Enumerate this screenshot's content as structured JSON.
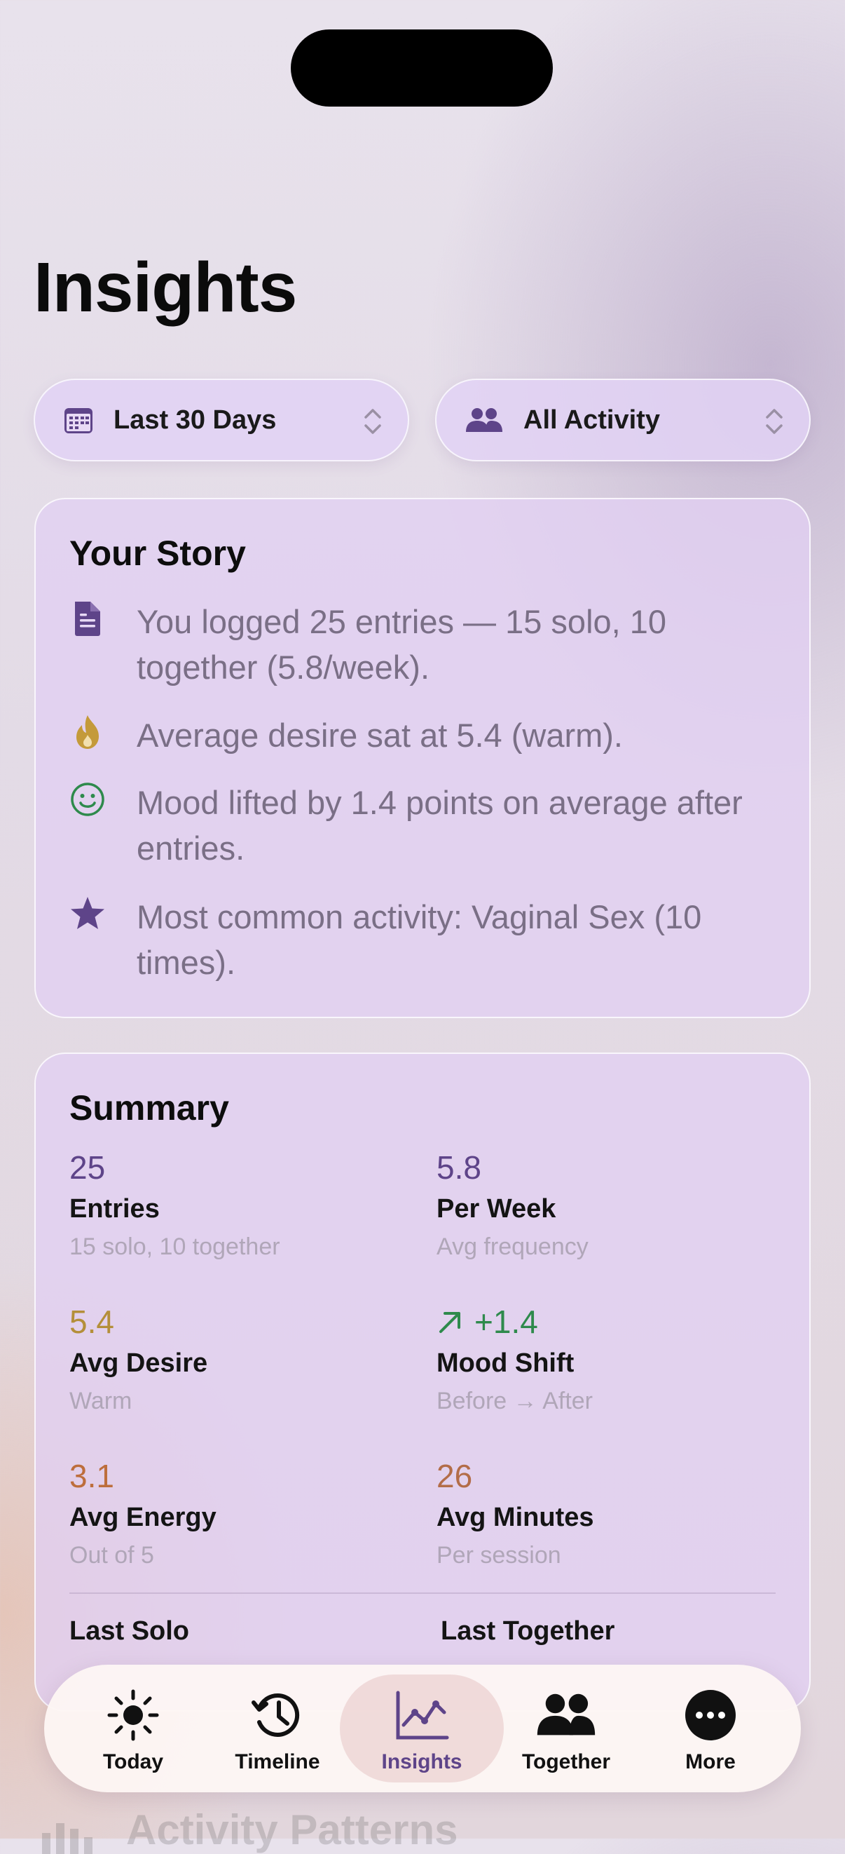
{
  "page": {
    "title": "Insights"
  },
  "filters": {
    "range": {
      "label": "Last 30 Days",
      "icon": "calendar-icon"
    },
    "activity": {
      "label": "All Activity",
      "icon": "people-icon"
    }
  },
  "story": {
    "title": "Your Story",
    "items": [
      {
        "icon": "document-icon",
        "color": "#5e4489",
        "text": "You logged 25 entries — 15 solo, 10 together (5.8/week)."
      },
      {
        "icon": "flame-icon",
        "color": "#c49a3a",
        "text": "Average desire sat at 5.4 (warm)."
      },
      {
        "icon": "smiley-icon",
        "color": "#2e8a4c",
        "text": "Mood lifted by 1.4 points on average after entries."
      },
      {
        "icon": "star-icon",
        "color": "#5e4489",
        "text": "Most common activity: Vaginal Sex (10 times)."
      }
    ]
  },
  "summary": {
    "title": "Summary",
    "stats": [
      {
        "value": "25",
        "label": "Entries",
        "sub": "15 solo, 10 together",
        "color": "#5e4489"
      },
      {
        "value": "5.8",
        "label": "Per Week",
        "sub": "Avg frequency",
        "color": "#5e4489"
      },
      {
        "value": "5.4",
        "label": "Avg Desire",
        "sub": "Warm",
        "color": "#b48f3a"
      },
      {
        "value": "+1.4",
        "label": "Mood Shift",
        "sub": "Before → After",
        "color": "#2e8a4c",
        "icon": "arrow-up-right-icon"
      },
      {
        "value": "3.1",
        "label": "Avg Energy",
        "sub": "Out of 5",
        "color": "#bd6e3c"
      },
      {
        "value": "26",
        "label": "Avg Minutes",
        "sub": "Per session",
        "color": "#b36d48"
      }
    ],
    "last_solo": {
      "label": "Last Solo"
    },
    "last_together": {
      "label": "Last Together"
    }
  },
  "next_section": {
    "title": "Activity Patterns",
    "icon": "bar-chart-icon"
  },
  "tabbar": {
    "active": "Insights",
    "tabs": [
      {
        "label": "Today",
        "icon": "sun-icon"
      },
      {
        "label": "Timeline",
        "icon": "clock-history-icon"
      },
      {
        "label": "Insights",
        "icon": "line-chart-icon"
      },
      {
        "label": "Together",
        "icon": "people-icon"
      },
      {
        "label": "More",
        "icon": "ellipsis-circle-icon"
      }
    ]
  }
}
